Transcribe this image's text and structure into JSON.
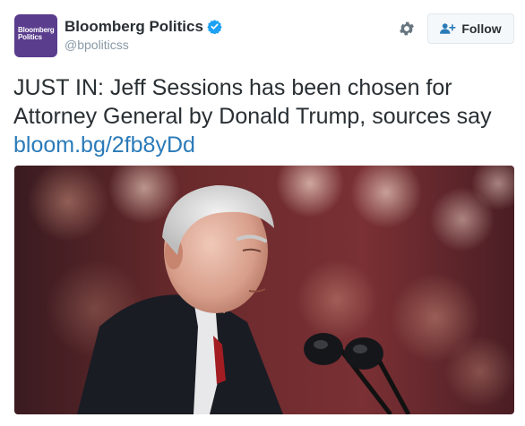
{
  "account": {
    "name": "Bloomberg Politics",
    "handle": "@bpoliticss",
    "avatar_line1": "Bloomberg",
    "avatar_line2": "Politics",
    "verified": true
  },
  "header": {
    "follow_label": "Follow"
  },
  "tweet": {
    "line1": "JUST IN: Jeff Sessions has been chosen for",
    "line2": "Attorney General by Donald Trump, sources say",
    "link": "bloom.bg/2fb8yDd"
  },
  "colors": {
    "brand": "#5a3d8d",
    "link": "#2b7bb9",
    "verified": "#1da1f2"
  },
  "icons": {
    "settings": "gear-icon",
    "follow": "add-user-icon",
    "verified": "verified-badge-icon"
  }
}
